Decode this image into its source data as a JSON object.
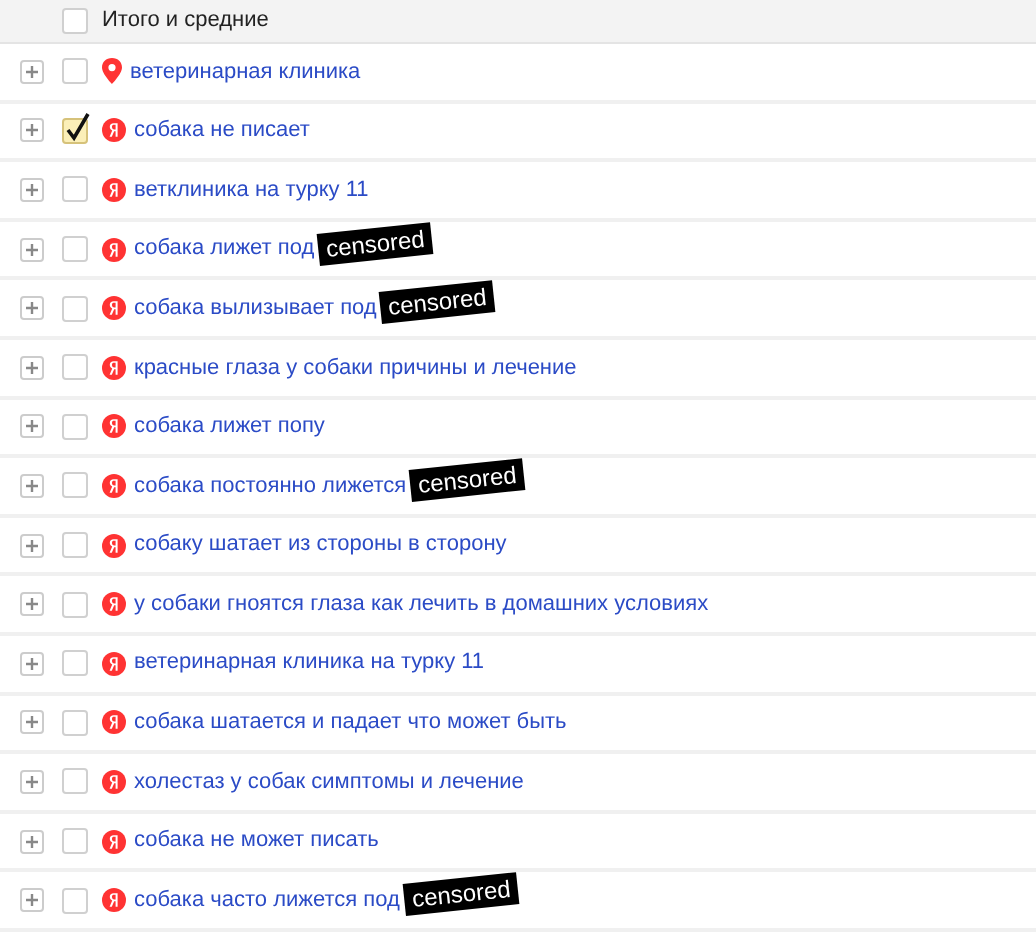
{
  "header": {
    "label": "Итого и средние",
    "checked": false
  },
  "rows": [
    {
      "kind": "pin",
      "text": "ветеринарная клиника",
      "checked": false
    },
    {
      "kind": "yandex",
      "text": "собака не писает",
      "checked": true
    },
    {
      "kind": "yandex",
      "text": "ветклиника на турку 11",
      "checked": false
    },
    {
      "kind": "yandex",
      "text": "собака лижет под",
      "checked": false,
      "sticker": "censored"
    },
    {
      "kind": "yandex",
      "text": "собака вылизывает под",
      "checked": false,
      "sticker": "censored"
    },
    {
      "kind": "yandex",
      "text": "красные глаза у собаки причины и лечение",
      "checked": false
    },
    {
      "kind": "yandex",
      "text": "собака лижет попу",
      "checked": false
    },
    {
      "kind": "yandex",
      "text": "собака постоянно лижется",
      "checked": false,
      "sticker": "censored"
    },
    {
      "kind": "yandex",
      "text": "собаку шатает из стороны в сторону",
      "checked": false
    },
    {
      "kind": "yandex",
      "text": "у собаки гноятся глаза как лечить в домашних условиях",
      "checked": false
    },
    {
      "kind": "yandex",
      "text": "ветеринарная клиника на турку 11",
      "checked": false
    },
    {
      "kind": "yandex",
      "text": "собака шатается и падает что может быть",
      "checked": false
    },
    {
      "kind": "yandex",
      "text": "холестаз у собак симптомы и лечение",
      "checked": false
    },
    {
      "kind": "yandex",
      "text": "собака не может писать",
      "checked": false
    },
    {
      "kind": "yandex",
      "text": "собака часто лижется под",
      "checked": false,
      "sticker": "censored"
    }
  ]
}
